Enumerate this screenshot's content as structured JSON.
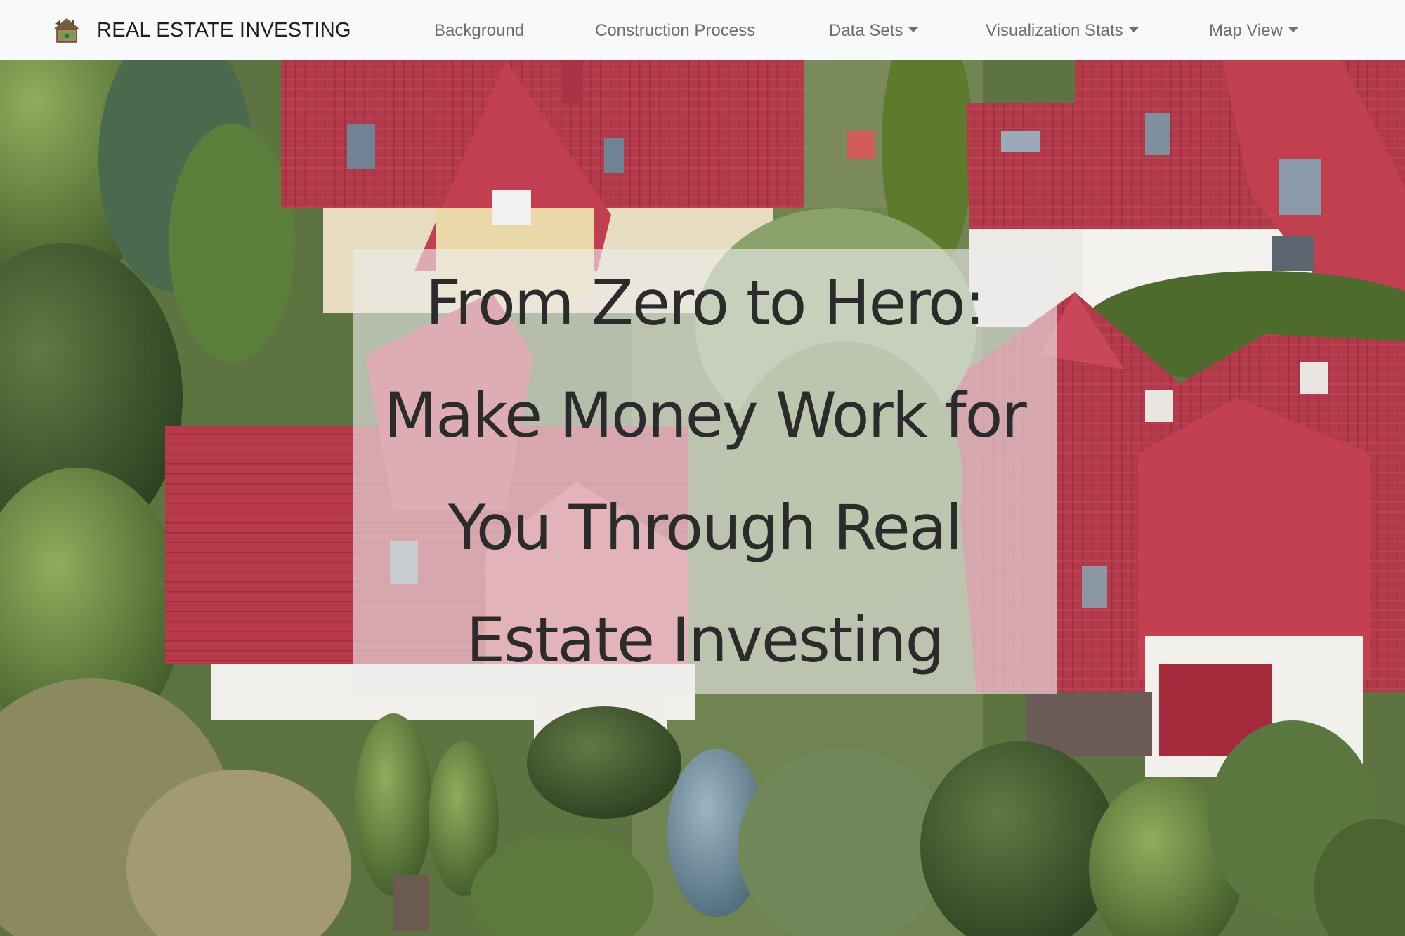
{
  "navbar": {
    "brand_text": "REAL ESTATE INVESTING",
    "brand_icon": "house-with-money-icon",
    "items": [
      {
        "label": "Background",
        "has_dropdown": false
      },
      {
        "label": "Construction Process",
        "has_dropdown": false
      },
      {
        "label": "Data Sets",
        "has_dropdown": true
      },
      {
        "label": "Visualization Stats",
        "has_dropdown": true
      },
      {
        "label": "Map View",
        "has_dropdown": true
      }
    ]
  },
  "hero": {
    "headline": "From Zero to Hero: Make Money Work for You Through Real Estate Investing"
  },
  "colors": {
    "navbar_bg": "#f8f9fa",
    "nav_text": "#6c6f73",
    "brand_text": "#1d1f22",
    "headline_text": "#2b2b2b",
    "roof_red": "#b8394a",
    "foliage_green": "#4f6b34"
  }
}
